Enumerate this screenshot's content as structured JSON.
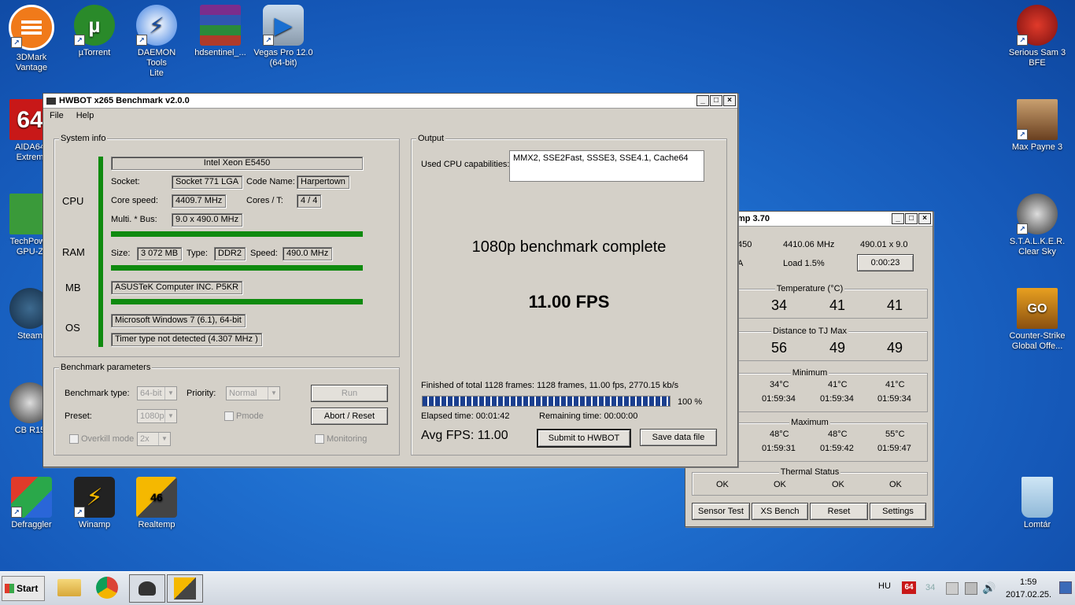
{
  "desktop": {
    "left_icons": [
      {
        "name": "3dmark-icon",
        "label": "3DMark\nVantage"
      },
      {
        "name": "utorrent-icon",
        "label": "µTorrent"
      },
      {
        "name": "daemon-tools-icon",
        "label": "DAEMON Tools\nLite"
      },
      {
        "name": "winrar-icon",
        "label": "hdsentinel_..."
      },
      {
        "name": "vegas-icon",
        "label": "Vegas Pro 12.0\n(64-bit)"
      }
    ],
    "side_icons": {
      "aida": "AIDA64\nExtrem",
      "techpower": "TechPowe\nGPU-Z",
      "steam": "Steam",
      "cb": "CB R15",
      "defraggler": "Defraggler",
      "winamp": "Winamp",
      "realtemp": "Realtemp"
    },
    "right_icons": {
      "serious_sam": "Serious Sam 3\nBFE",
      "max_payne": "Max Payne 3",
      "stalker": "S.T.A.L.K.E.R.\nClear Sky",
      "csgo": "Counter-Strike\nGlobal Offe...",
      "recycle": "Lomtár"
    },
    "icon_glyphs": {
      "aida": "64",
      "cs": "GO",
      "realtemp": "46"
    }
  },
  "hwbot": {
    "title": "HWBOT x265 Benchmark v2.0.0",
    "menu": [
      "File",
      "Help"
    ],
    "system_info": {
      "legend": "System info",
      "cpu_label": "CPU",
      "ram_label": "RAM",
      "mb_label": "MB",
      "os_label": "OS",
      "cpu_name": "Intel Xeon E5450",
      "socket_label": "Socket:",
      "socket": "Socket 771 LGA",
      "codename_label": "Code Name:",
      "codename": "Harpertown",
      "corespeed_label": "Core speed:",
      "corespeed": "4409.7 MHz",
      "cores_label": "Cores / T:",
      "cores": "4 / 4",
      "multi_label": "Multi. * Bus:",
      "multi": "9.0 x 490.0 MHz",
      "size_label": "Size:",
      "size": "3 072 MB",
      "type_label": "Type:",
      "type": "DDR2",
      "speed_label": "Speed:",
      "speed": "490.0 MHz",
      "mb": "ASUSTeK Computer INC. P5KR",
      "os": "Microsoft Windows 7 (6.1), 64-bit",
      "timer": "Timer type not detected (4.307 MHz )"
    },
    "params": {
      "legend": "Benchmark parameters",
      "type_label": "Benchmark type:",
      "type_value": "64-bit",
      "priority_label": "Priority:",
      "priority_value": "Normal",
      "preset_label": "Preset:",
      "preset_value": "1080p",
      "pmode_label": "Pmode",
      "overkill_label": "Overkill mode",
      "overkill_value": "2x",
      "monitoring_label": "Monitoring",
      "run_label": "Run",
      "abort_label": "Abort / Reset"
    },
    "output": {
      "legend": "Output",
      "caps_label": "Used CPU capabilities:",
      "caps": "MMX2, SSE2Fast, SSSE3, SSE4.1, Cache64",
      "complete": "1080p benchmark complete",
      "fps": "11.00 FPS",
      "finished": "Finished of total 1128 frames: 1128 frames, 11.00 fps,  2770.15 kb/s",
      "progress_pct": "100 %",
      "progress": 1.0,
      "elapsed": "Elapsed time: 00:01:42",
      "remaining": "Remaining time: 00:00:00",
      "avg": "Avg FPS: 11.00",
      "submit_label": "Submit to HWBOT",
      "save_label": "Save data file"
    }
  },
  "realtemp": {
    "title": "mp 3.70",
    "row1": {
      "a": "450",
      "mhz": "4410.06 MHz",
      "mult": "490.01 x 9.0"
    },
    "row2": {
      "a": "A",
      "load": "Load  1.5%",
      "timer": "0:00:23"
    },
    "temperature": {
      "cap": "Temperature (°C)",
      "values": [
        "34",
        "41",
        "41"
      ]
    },
    "distance": {
      "cap": "Distance to TJ Max",
      "values": [
        "56",
        "49",
        "49"
      ]
    },
    "minimum": {
      "cap": "Minimum",
      "temps": [
        "34°C",
        "41°C",
        "41°C"
      ],
      "times": [
        "01:59:34",
        "01:59:34",
        "01:59:34"
      ]
    },
    "maximum": {
      "cap": "Maximum",
      "temps": [
        "48°C",
        "48°C",
        "55°C"
      ],
      "times": [
        "01:59:31",
        "01:59:42",
        "01:59:47"
      ]
    },
    "thermal": {
      "cap": "Thermal Status",
      "values": [
        "OK",
        "OK",
        "OK",
        "OK"
      ]
    },
    "buttons": {
      "sensor": "Sensor Test",
      "xs": "XS Bench",
      "reset": "Reset",
      "settings": "Settings"
    }
  },
  "taskbar": {
    "start": "Start",
    "lang": "HU",
    "tray_num": "34",
    "tray_64": "64",
    "time": "1:59",
    "date": "2017.02.25."
  }
}
